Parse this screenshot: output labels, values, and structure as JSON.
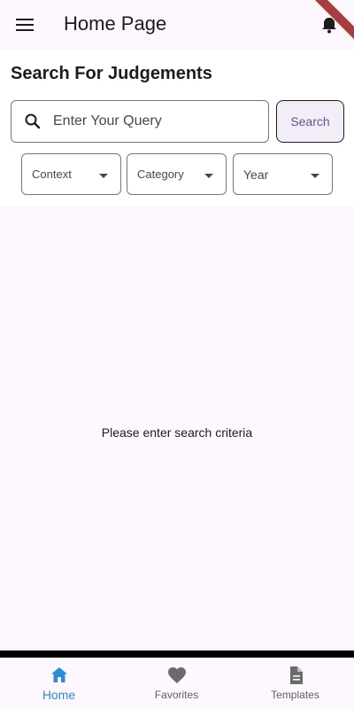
{
  "appbar": {
    "title": "Home Page",
    "menu_icon": "menu-icon",
    "notification_icon": "bell-icon"
  },
  "search": {
    "heading": "Search For Judgements",
    "placeholder": "Enter Your Query",
    "value": "",
    "button_label": "Search"
  },
  "filters": {
    "context": {
      "label": "Context"
    },
    "category": {
      "label": "Category"
    },
    "year": {
      "label": "Year"
    }
  },
  "results": {
    "empty_message": "Please enter search criteria"
  },
  "bottom_nav": {
    "items": [
      {
        "label": "Home",
        "icon": "home-icon",
        "active": true
      },
      {
        "label": "Favorites",
        "icon": "heart-icon",
        "active": false
      },
      {
        "label": "Templates",
        "icon": "document-icon",
        "active": false
      }
    ]
  },
  "colors": {
    "background": "#fdf7fe",
    "accent_active": "#2b8ad9",
    "search_button_text": "#65558f",
    "debug_banner": "#a73e3e"
  }
}
